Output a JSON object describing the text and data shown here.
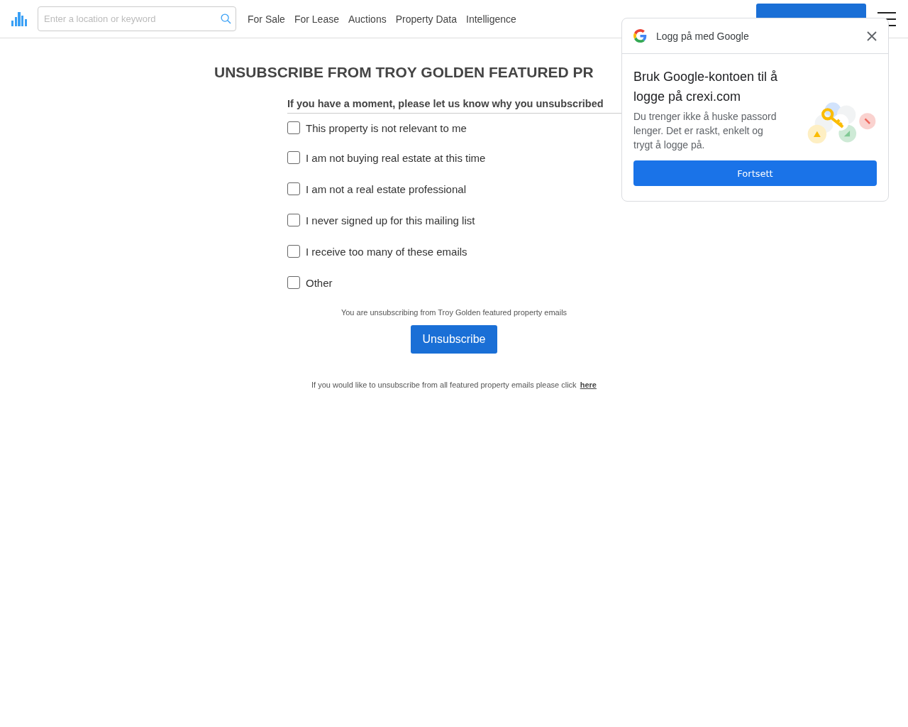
{
  "header": {
    "search": {
      "placeholder": "Enter a location or keyword"
    },
    "nav": [
      "For Sale",
      "For Lease",
      "Auctions",
      "Property Data",
      "Intelligence"
    ]
  },
  "page": {
    "title": "UNSUBSCRIBE FROM TROY GOLDEN FEATURED PR",
    "prompt": "If you have a moment, please let us know why you unsubscribed",
    "reasons": [
      {
        "label": "This property is not relevant to me",
        "checked": false
      },
      {
        "label": "I am not buying real estate at this time",
        "checked": false
      },
      {
        "label": "I am not a real estate professional",
        "checked": false
      },
      {
        "label": "I never signed up for this mailing list",
        "checked": false
      },
      {
        "label": "I receive too many of these emails",
        "checked": false
      },
      {
        "label": "Other",
        "checked": false
      }
    ],
    "note": "You are unsubscribing from Troy Golden featured property emails",
    "button": "Unsubscribe",
    "footer": "If you would like to unsubscribe from all featured property emails please click",
    "footer_link": "here"
  },
  "google_popup": {
    "title": "Logg på med Google",
    "heading": "Bruk Google-kontoen til å logge på crexi.com",
    "body": "Du trenger ikke å huske passord lenger. Det er raskt, enkelt og trygt å logge på.",
    "button": "Fortsett"
  }
}
